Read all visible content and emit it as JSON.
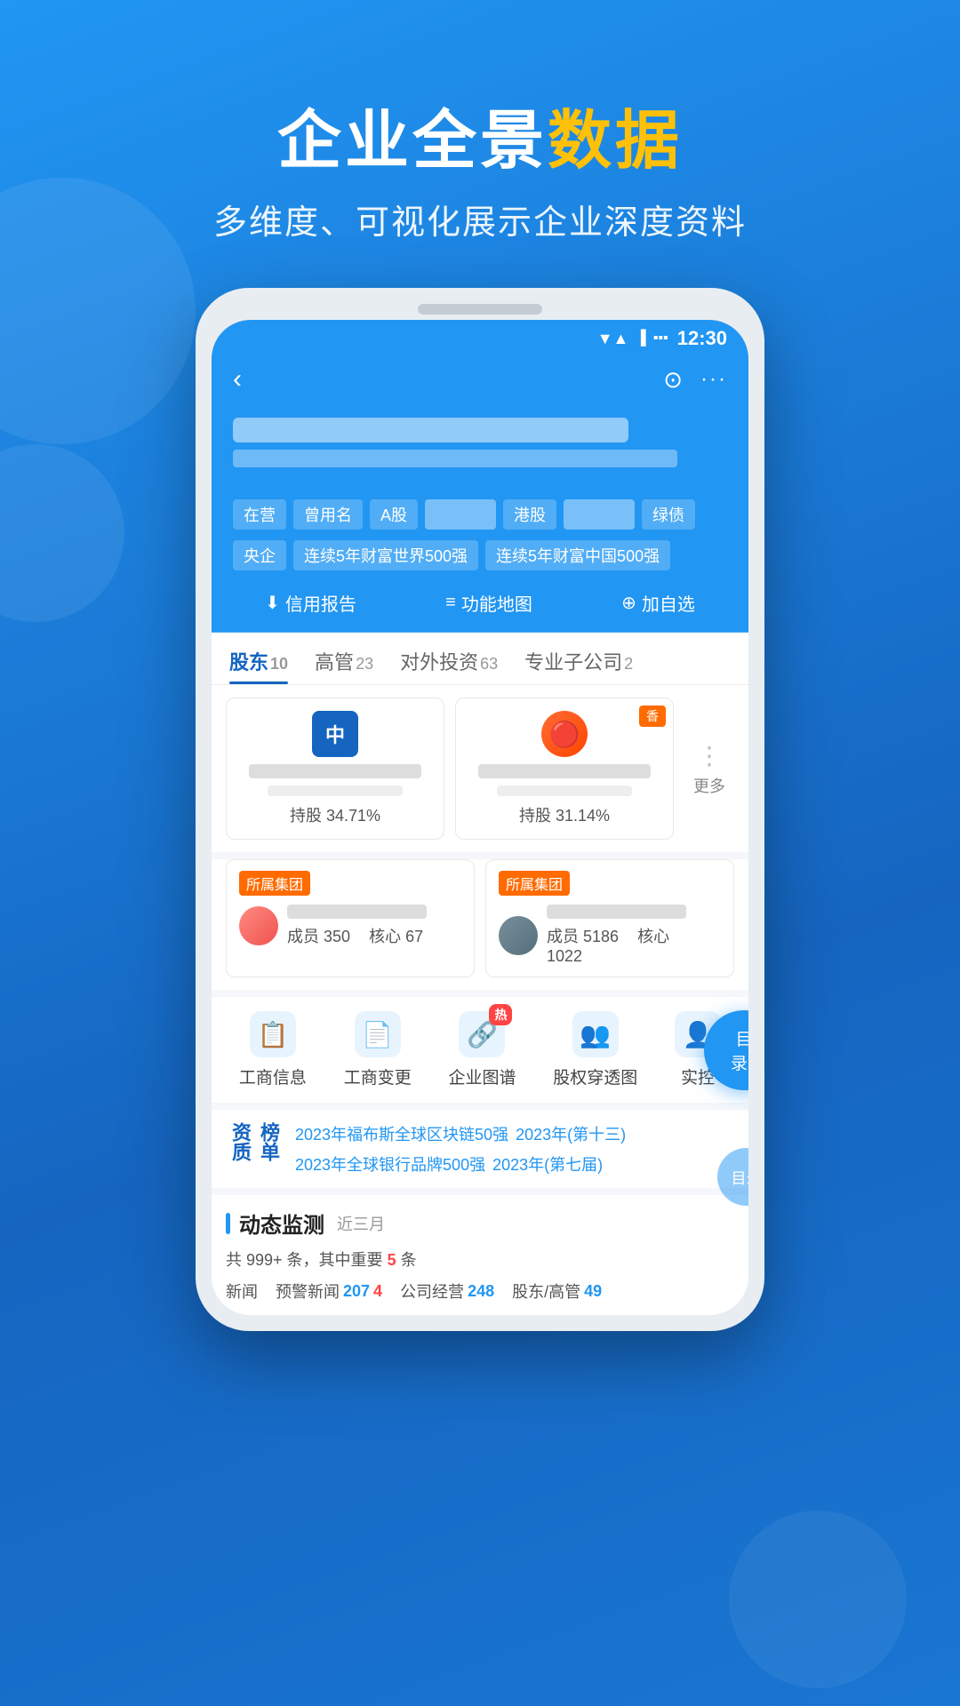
{
  "header": {
    "title_part1": "企业全景",
    "title_part2": "数据",
    "subtitle": "多维度、可视化展示企业深度资料"
  },
  "statusBar": {
    "time": "12:30",
    "wifi": "▼",
    "signal": "▲",
    "battery": "🔋"
  },
  "nav": {
    "back": "‹",
    "search": "⊙",
    "more": "···"
  },
  "tags": {
    "row1": [
      "在营",
      "曾用名",
      "A股",
      "港股",
      "绿债"
    ],
    "row2": [
      "央企",
      "连续5年财富世界500强",
      "连续5年财富中国500强"
    ]
  },
  "actions": {
    "credit": "信用报告",
    "map": "功能地图",
    "addWatch": "加自选"
  },
  "tabs": [
    {
      "label": "股东",
      "num": "10"
    },
    {
      "label": "高管",
      "num": "23"
    },
    {
      "label": "对外投资",
      "num": "63"
    },
    {
      "label": "专业子公司",
      "num": "2"
    }
  ],
  "shareholders": [
    {
      "id": "中",
      "percent": "持股 34.71%"
    },
    {
      "id": "🔴",
      "percent": "持股 31.14%"
    },
    {
      "label": "香",
      "more": "更多"
    }
  ],
  "groups": [
    {
      "tag": "所属集团",
      "memberCount": "350",
      "coreCount": "67"
    },
    {
      "tag": "所属集团",
      "memberCount": "5186",
      "coreCount": "1022"
    }
  ],
  "menuIcons": [
    {
      "label": "工商信息",
      "icon": "📋",
      "hot": false
    },
    {
      "label": "工商变更",
      "icon": "📄",
      "hot": false
    },
    {
      "label": "企业图谱",
      "icon": "🔗",
      "hot": true
    },
    {
      "label": "股权穿透图",
      "icon": "👤",
      "hot": false
    },
    {
      "label": "实控",
      "icon": "👤",
      "hot": false
    }
  ],
  "bangdan": {
    "title": "榜单\n资质",
    "links": [
      "2023年福布斯全球区块链50强",
      "2023年(第十三)",
      "2023年全球银行品牌500强",
      "2023年(第七届)"
    ]
  },
  "dongtai": {
    "title": "动态监测",
    "period": "近三月",
    "totalText": "共 999+ 条，其中重要",
    "importantNum": "5",
    "importantUnit": "条",
    "items": [
      {
        "label": "新闻",
        "num": ""
      },
      {
        "label": "预警新闻",
        "num1": "207",
        "num2": "4"
      },
      {
        "label": "公司经营",
        "num": "248"
      },
      {
        "label": "股东/高管",
        "num": "49"
      }
    ]
  },
  "floatBtn": {
    "label1": "目",
    "label2": "录≡"
  }
}
